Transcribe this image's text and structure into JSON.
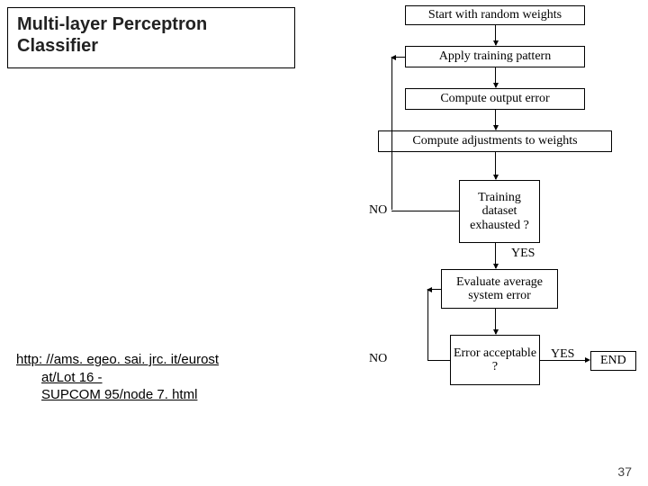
{
  "title": "Multi-layer Perceptron Classifier",
  "link_line1": "http: //ams. egeo. sai. jrc. it/eurost",
  "link_line2": "at/Lot 16 -",
  "link_line3": "SUPCOM 95/node 7. html",
  "flow": {
    "step1": "Start with random weights",
    "step2": "Apply training pattern",
    "step3": "Compute output error",
    "step4": "Compute adjustments to weights",
    "decision1": "Training dataset exhausted ?",
    "step5": "Evaluate average system error",
    "decision2": "Error acceptable ?",
    "no": "NO",
    "yes": "YES",
    "end": "END"
  },
  "page_number": "37"
}
